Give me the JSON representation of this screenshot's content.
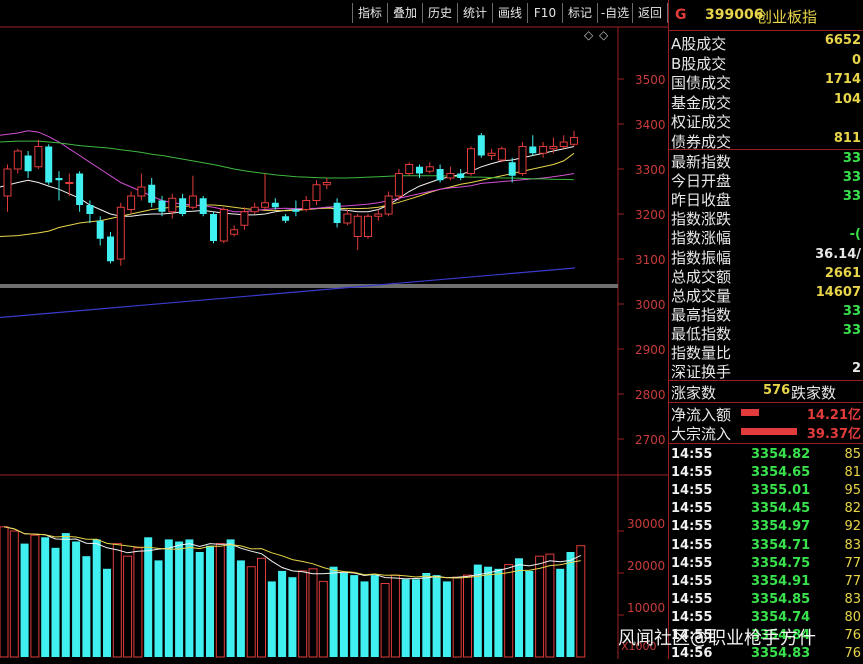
{
  "toolbar": {
    "buttons": [
      "指标",
      "叠加",
      "历史",
      "统计",
      "画线",
      "F10",
      "标记",
      "-自选",
      "返回"
    ]
  },
  "header": {
    "badge": "G",
    "code": "399006",
    "name": "创业板指"
  },
  "price_axis": [
    "3500",
    "3400",
    "3300",
    "3200",
    "3100",
    "3000",
    "2900",
    "2800",
    "2700"
  ],
  "volume_axis": [
    "30000",
    "20000",
    "10000"
  ],
  "volume_unit": "X1000",
  "stats": [
    {
      "label": "A股成交",
      "value": "6652"
    },
    {
      "label": "B股成交",
      "value": "0"
    },
    {
      "label": "国债成交",
      "value": "1714"
    },
    {
      "label": "基金成交",
      "value": "104"
    },
    {
      "label": "权证成交",
      "value": ""
    },
    {
      "label": "债券成交",
      "value": "811"
    }
  ],
  "indices": [
    {
      "label": "最新指数",
      "value": "33"
    },
    {
      "label": "今日开盘",
      "value": "33"
    },
    {
      "label": "昨日收盘",
      "value": "33"
    },
    {
      "label": "指数涨跌",
      "value": ""
    },
    {
      "label": "指数涨幅",
      "value": "-("
    },
    {
      "label": "指数振幅",
      "value": "36.14/"
    },
    {
      "label": "总成交额",
      "value": "2661"
    },
    {
      "label": "总成交量",
      "value": "14607"
    },
    {
      "label": "最高指数",
      "value": "33"
    },
    {
      "label": "最低指数",
      "value": "33"
    },
    {
      "label": "指数量比",
      "value": ""
    },
    {
      "label": "深证换手",
      "value": "2"
    }
  ],
  "breadth": {
    "up_label": "涨家数",
    "up_count": "576",
    "down_label": "跌家数"
  },
  "flows": [
    {
      "label": "净流入额",
      "value": "14.21亿"
    },
    {
      "label": "大宗流入",
      "value": "39.37亿"
    }
  ],
  "trades": [
    {
      "time": "14:55",
      "price": "3354.82",
      "vol": "85"
    },
    {
      "time": "14:55",
      "price": "3354.65",
      "vol": "81"
    },
    {
      "time": "14:55",
      "price": "3355.01",
      "vol": "95"
    },
    {
      "time": "14:55",
      "price": "3354.45",
      "vol": "82"
    },
    {
      "time": "14:55",
      "price": "3354.97",
      "vol": "92"
    },
    {
      "time": "14:55",
      "price": "3354.71",
      "vol": "83"
    },
    {
      "time": "14:55",
      "price": "3354.75",
      "vol": "77"
    },
    {
      "time": "14:55",
      "price": "3354.91",
      "vol": "77"
    },
    {
      "time": "14:55",
      "price": "3354.85",
      "vol": "83"
    },
    {
      "time": "14:55",
      "price": "3354.74",
      "vol": "80"
    },
    {
      "time": "14:55",
      "price": "3354.84",
      "vol": "76"
    },
    {
      "time": "14:56",
      "price": "3354.83",
      "vol": "76"
    }
  ],
  "watermark": "风闻社区@职业枪手方什",
  "colors": {
    "up": "#e23b3b",
    "down": "#40f0f0",
    "ma1": "#f2f2f2",
    "ma2": "#e8d54a",
    "ma3": "#d44fd4",
    "ma4": "#3fb83f",
    "ma5": "#3a3acd",
    "axis": "#9c1f1f"
  },
  "candles": [
    {
      "o": 3240,
      "c": 3300,
      "h": 3310,
      "l": 3205
    },
    {
      "o": 3300,
      "c": 3340,
      "h": 3345,
      "l": 3290
    },
    {
      "o": 3330,
      "c": 3295,
      "h": 3340,
      "l": 3280
    },
    {
      "o": 3305,
      "c": 3350,
      "h": 3365,
      "l": 3300
    },
    {
      "o": 3350,
      "c": 3270,
      "h": 3355,
      "l": 3265
    },
    {
      "o": 3280,
      "c": 3275,
      "h": 3295,
      "l": 3230
    },
    {
      "o": 3270,
      "c": 3270,
      "h": 3290,
      "l": 3240
    },
    {
      "o": 3290,
      "c": 3220,
      "h": 3295,
      "l": 3205
    },
    {
      "o": 3220,
      "c": 3200,
      "h": 3230,
      "l": 3180
    },
    {
      "o": 3185,
      "c": 3145,
      "h": 3195,
      "l": 3130
    },
    {
      "o": 3150,
      "c": 3095,
      "h": 3160,
      "l": 3090
    },
    {
      "o": 3100,
      "c": 3215,
      "h": 3225,
      "l": 3085
    },
    {
      "o": 3210,
      "c": 3240,
      "h": 3250,
      "l": 3200
    },
    {
      "o": 3240,
      "c": 3260,
      "h": 3290,
      "l": 3230
    },
    {
      "o": 3265,
      "c": 3225,
      "h": 3280,
      "l": 3215
    },
    {
      "o": 3230,
      "c": 3205,
      "h": 3240,
      "l": 3195
    },
    {
      "o": 3205,
      "c": 3235,
      "h": 3245,
      "l": 3190
    },
    {
      "o": 3235,
      "c": 3200,
      "h": 3245,
      "l": 3195
    },
    {
      "o": 3215,
      "c": 3240,
      "h": 3285,
      "l": 3210
    },
    {
      "o": 3235,
      "c": 3200,
      "h": 3240,
      "l": 3195
    },
    {
      "o": 3200,
      "c": 3140,
      "h": 3205,
      "l": 3135
    },
    {
      "o": 3140,
      "c": 3210,
      "h": 3215,
      "l": 3135
    },
    {
      "o": 3155,
      "c": 3165,
      "h": 3175,
      "l": 3150
    },
    {
      "o": 3175,
      "c": 3205,
      "h": 3215,
      "l": 3165
    },
    {
      "o": 3205,
      "c": 3215,
      "h": 3225,
      "l": 3200
    },
    {
      "o": 3215,
      "c": 3225,
      "h": 3290,
      "l": 3210
    },
    {
      "o": 3225,
      "c": 3215,
      "h": 3235,
      "l": 3210
    },
    {
      "o": 3195,
      "c": 3185,
      "h": 3200,
      "l": 3180
    },
    {
      "o": 3210,
      "c": 3205,
      "h": 3230,
      "l": 3195
    },
    {
      "o": 3210,
      "c": 3230,
      "h": 3240,
      "l": 3205
    },
    {
      "o": 3230,
      "c": 3265,
      "h": 3275,
      "l": 3220
    },
    {
      "o": 3265,
      "c": 3270,
      "h": 3280,
      "l": 3255
    },
    {
      "o": 3225,
      "c": 3180,
      "h": 3235,
      "l": 3170
    },
    {
      "o": 3180,
      "c": 3200,
      "h": 3210,
      "l": 3175
    },
    {
      "o": 3150,
      "c": 3195,
      "h": 3200,
      "l": 3120
    },
    {
      "o": 3150,
      "c": 3195,
      "h": 3200,
      "l": 3145
    },
    {
      "o": 3195,
      "c": 3200,
      "h": 3210,
      "l": 3185
    },
    {
      "o": 3200,
      "c": 3240,
      "h": 3250,
      "l": 3195
    },
    {
      "o": 3240,
      "c": 3290,
      "h": 3300,
      "l": 3230
    },
    {
      "o": 3290,
      "c": 3310,
      "h": 3315,
      "l": 3285
    },
    {
      "o": 3305,
      "c": 3290,
      "h": 3310,
      "l": 3280
    },
    {
      "o": 3295,
      "c": 3305,
      "h": 3315,
      "l": 3290
    },
    {
      "o": 3300,
      "c": 3275,
      "h": 3310,
      "l": 3270
    },
    {
      "o": 3280,
      "c": 3290,
      "h": 3305,
      "l": 3275
    },
    {
      "o": 3290,
      "c": 3280,
      "h": 3300,
      "l": 3275
    },
    {
      "o": 3290,
      "c": 3345,
      "h": 3350,
      "l": 3285
    },
    {
      "o": 3375,
      "c": 3330,
      "h": 3380,
      "l": 3325
    },
    {
      "o": 3330,
      "c": 3335,
      "h": 3345,
      "l": 3320
    },
    {
      "o": 3320,
      "c": 3345,
      "h": 3350,
      "l": 3315
    },
    {
      "o": 3315,
      "c": 3285,
      "h": 3325,
      "l": 3270
    },
    {
      "o": 3290,
      "c": 3350,
      "h": 3360,
      "l": 3285
    },
    {
      "o": 3350,
      "c": 3335,
      "h": 3375,
      "l": 3330
    },
    {
      "o": 3335,
      "c": 3350,
      "h": 3360,
      "l": 3325
    },
    {
      "o": 3345,
      "c": 3350,
      "h": 3370,
      "l": 3335
    },
    {
      "o": 3350,
      "c": 3360,
      "h": 3375,
      "l": 3345
    },
    {
      "o": 3355,
      "c": 3370,
      "h": 3385,
      "l": 3350
    }
  ],
  "volumes": [
    31000,
    30000,
    27000,
    29000,
    28500,
    26000,
    29500,
    27500,
    24000,
    28000,
    21000,
    27000,
    24000,
    26000,
    28500,
    23000,
    28000,
    27500,
    28000,
    25000,
    26500,
    27000,
    28000,
    23000,
    21500,
    23500,
    18000,
    20500,
    19000,
    20500,
    21000,
    18000,
    21500,
    20000,
    19500,
    18000,
    19500,
    17500,
    19500,
    18500,
    18500,
    20000,
    19500,
    18000,
    19000,
    19500,
    22000,
    21500,
    21000,
    22000,
    23500,
    20500,
    24000,
    24500,
    21000,
    25000,
    26500
  ],
  "ma_lines": {
    "ma_white": [
      3260,
      3270,
      3275,
      3270,
      3262,
      3255,
      3245,
      3235,
      3220,
      3210,
      3200,
      3195,
      3195,
      3198,
      3200,
      3200,
      3202,
      3205,
      3206,
      3208,
      3205,
      3202,
      3200,
      3198,
      3198,
      3200,
      3205,
      3208,
      3210,
      3210,
      3212,
      3215,
      3210,
      3208,
      3205,
      3205,
      3210,
      3220,
      3235,
      3250,
      3262,
      3270,
      3278,
      3283,
      3288,
      3295,
      3305,
      3312,
      3318,
      3320,
      3325,
      3330,
      3335,
      3340,
      3345,
      3350
    ],
    "ma_yellow": [
      3150,
      3152,
      3155,
      3158,
      3162,
      3170,
      3175,
      3180,
      3183,
      3185,
      3190,
      3195,
      3200,
      3205,
      3210,
      3213,
      3215,
      3217,
      3218,
      3220,
      3220,
      3218,
      3215,
      3212,
      3210,
      3208,
      3208,
      3207,
      3208,
      3210,
      3212,
      3213,
      3213,
      3212,
      3212,
      3213,
      3215,
      3220,
      3226,
      3233,
      3240,
      3248,
      3255,
      3260,
      3266,
      3270,
      3275,
      3280,
      3285,
      3290,
      3295,
      3300,
      3305,
      3310,
      3318,
      3335
    ],
    "ma_magenta": [
      3375,
      3380,
      3385,
      3382,
      3372,
      3360,
      3345,
      3330,
      3315,
      3300,
      3285,
      3270,
      3260,
      3250,
      3240,
      3230,
      3225,
      3222,
      3220,
      3218,
      3215,
      3210,
      3205,
      3205,
      3208,
      3210,
      3212,
      3213,
      3212,
      3212,
      3213,
      3215,
      3217,
      3218,
      3220,
      3222,
      3225,
      3230,
      3235,
      3240,
      3245,
      3250,
      3255,
      3258,
      3260,
      3263,
      3268,
      3270,
      3272,
      3274,
      3276,
      3278,
      3280,
      3283,
      3286,
      3290
    ],
    "ma_green": [
      3360,
      3362,
      3362,
      3362,
      3360,
      3358,
      3355,
      3352,
      3350,
      3348,
      3346,
      3343,
      3340,
      3337,
      3333,
      3330,
      3326,
      3322,
      3318,
      3314,
      3310,
      3305,
      3300,
      3296,
      3293,
      3290,
      3287,
      3285,
      3283,
      3282,
      3281,
      3280,
      3280,
      3280,
      3281,
      3282,
      3283,
      3284,
      3285,
      3285,
      3285,
      3285,
      3285,
      3284,
      3283,
      3282,
      3282,
      3281,
      3280,
      3280,
      3279,
      3278,
      3278,
      3277,
      3277,
      3276
    ],
    "ma_blue_start": 2970,
    "ma_blue_end": 3080
  }
}
